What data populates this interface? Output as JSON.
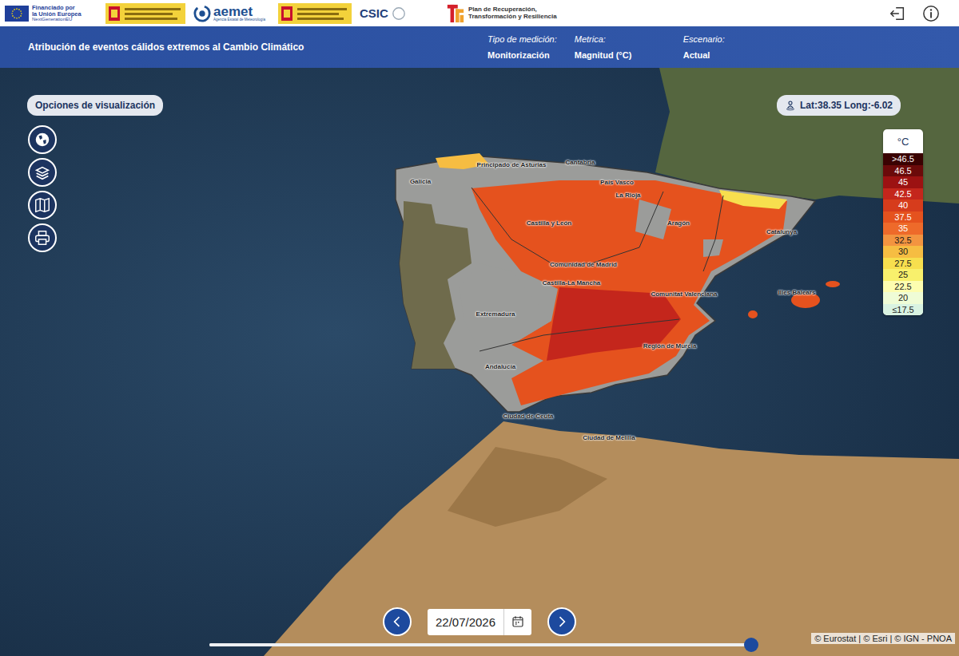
{
  "header": {
    "eu_lines": [
      "Financiado por",
      "la Unión Europea",
      "NextGenerationEU"
    ],
    "aemet": {
      "name": "aemet",
      "subtitle": "Agencia Estatal de Meteorología"
    },
    "csic": "CSIC",
    "plan": "Plan de Recuperación, Transformación y Resiliencia"
  },
  "toolbar": {
    "title": "Atribución de eventos cálidos extremos al Cambio Climático",
    "fields": [
      {
        "label": "Tipo de medición:",
        "value": "Monitorización"
      },
      {
        "label": "Metrica:",
        "value": "Magnitud (°C)"
      },
      {
        "label": "Escenario:",
        "value": "Actual"
      }
    ]
  },
  "map": {
    "options_label": "Opciones de visualización",
    "coordinates": "Lat:38.35 Long:-6.02",
    "regions": [
      "Principado de Asturias",
      "Cantabria",
      "Galicia",
      "País Vasco",
      "La Rioja",
      "Castilla y León",
      "Aragón",
      "Catalunya",
      "Comunidad de Madrid",
      "Castilla-La Mancha",
      "Comunitat Valenciana",
      "Illes Balears",
      "Extremadura",
      "Región de Murcia",
      "Andalucía",
      "Ciudad de Ceuta",
      "Ciudad de Melilla"
    ],
    "legend": {
      "unit": "°C",
      "items": [
        {
          "label": ">46.5",
          "color": "#3a0202"
        },
        {
          "label": "46.5",
          "color": "#6b0a0a"
        },
        {
          "label": "45",
          "color": "#9c1212"
        },
        {
          "label": "42.5",
          "color": "#c4261c"
        },
        {
          "label": "40",
          "color": "#d63c1c"
        },
        {
          "label": "37.5",
          "color": "#e5521e"
        },
        {
          "label": "35",
          "color": "#ee6a2a"
        },
        {
          "label": "32.5",
          "color": "#f39440"
        },
        {
          "label": "30",
          "color": "#f6bd42"
        },
        {
          "label": "27.5",
          "color": "#f7df4e"
        },
        {
          "label": "25",
          "color": "#f8f06c"
        },
        {
          "label": "22.5",
          "color": "#fdfdb0"
        },
        {
          "label": "20",
          "color": "#effcd6"
        },
        {
          "label": "≤17.5",
          "color": "#d9f3e2"
        }
      ]
    }
  },
  "timeline": {
    "date": "22/07/2026",
    "level": 0.988
  },
  "attribution": "© Eurostat | © Esri | © IGN - PNOA"
}
